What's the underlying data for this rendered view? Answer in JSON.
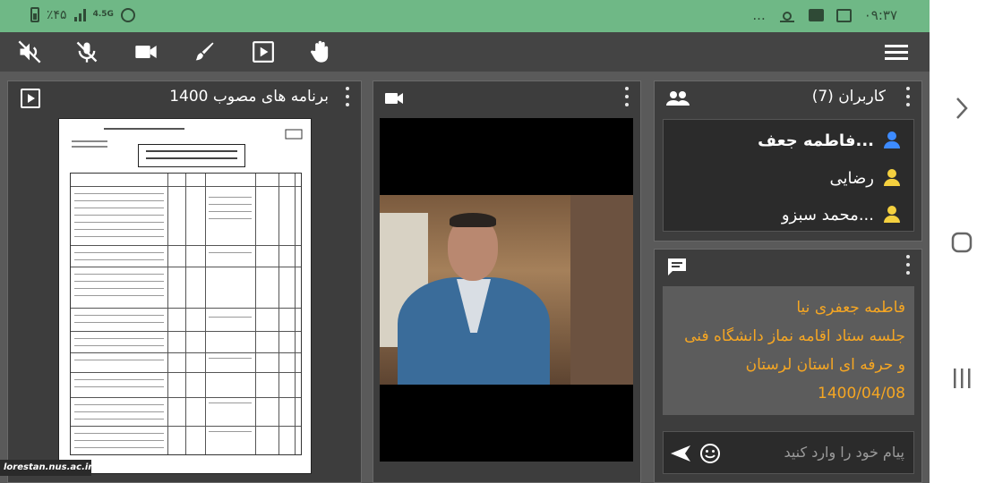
{
  "status_bar": {
    "time": "۰۹:۳۷",
    "battery": "٪۴۵",
    "network": "4.5G",
    "more": "..."
  },
  "panels": {
    "presentation": {
      "title": "برنامه های مصوب 1400"
    },
    "users": {
      "title": "کاربران (7)",
      "items": [
        {
          "name": "فاطمه جعف...",
          "color": "#3d8bff"
        },
        {
          "name": "رضایی",
          "color": "#f4d03f"
        },
        {
          "name": "محمد سبزو...",
          "color": "#f4d03f"
        }
      ]
    },
    "chat": {
      "message_lines": [
        "فاطمه جعفری نیا",
        "جلسه ستاد اقامه نماز دانشگاه فنی",
        "و حرفه ای استان لرستان",
        "1400/04/08"
      ],
      "input_placeholder": "پیام خود را وارد کنید"
    }
  },
  "watermark": "lorestan.nus.ac.ir",
  "colors": {
    "status_bar": "#6fb886",
    "accent_text": "#f5a623",
    "panel_bg": "#3d3d3d"
  }
}
